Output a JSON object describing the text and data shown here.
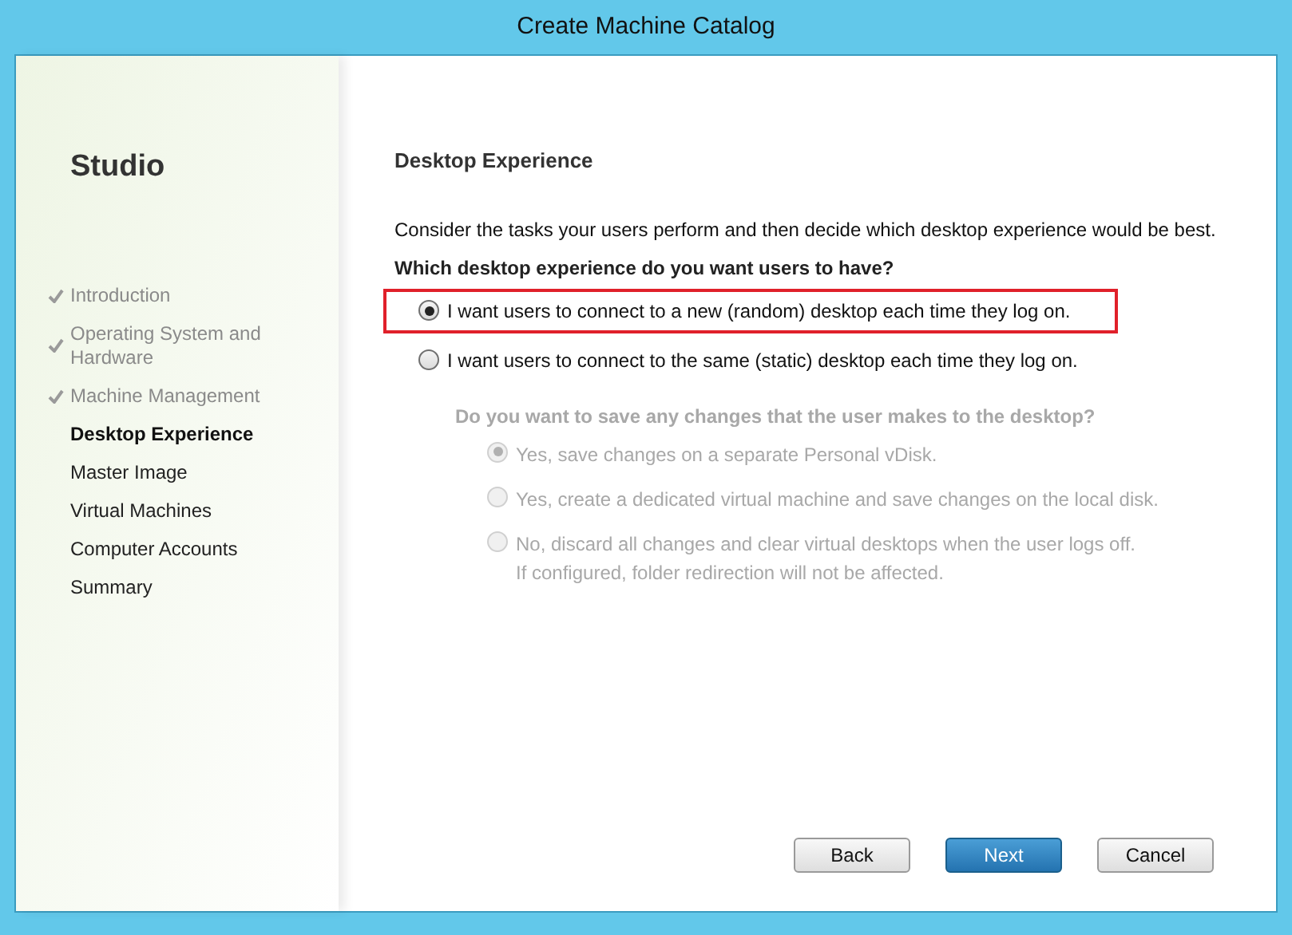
{
  "window": {
    "title": "Create Machine Catalog"
  },
  "sidebar": {
    "title": "Studio",
    "steps": [
      {
        "label": "Introduction",
        "completed": true,
        "selected": false
      },
      {
        "label": "Operating System and Hardware",
        "completed": true,
        "selected": false
      },
      {
        "label": "Machine Management",
        "completed": true,
        "selected": false
      },
      {
        "label": "Desktop Experience",
        "completed": false,
        "selected": true
      },
      {
        "label": "Master Image",
        "completed": false,
        "selected": false
      },
      {
        "label": "Virtual Machines",
        "completed": false,
        "selected": false
      },
      {
        "label": "Computer Accounts",
        "completed": false,
        "selected": false
      },
      {
        "label": "Summary",
        "completed": false,
        "selected": false
      }
    ]
  },
  "page": {
    "heading": "Desktop Experience",
    "intro": "Consider the tasks your users perform and then decide which desktop experience would be best.",
    "question": "Which desktop experience do you want users to have?",
    "options": [
      {
        "label": "I want users to connect to a new (random) desktop each time they log on.",
        "selected": true,
        "highlighted": true
      },
      {
        "label": "I want users to connect to the same (static) desktop each time they log on.",
        "selected": false,
        "highlighted": false
      }
    ],
    "sub_question": {
      "label": "Do you want to save any changes that the user makes to the desktop?",
      "disabled": true,
      "options": [
        {
          "label": "Yes, save changes on a separate Personal vDisk.",
          "selected": true
        },
        {
          "label": "Yes, create a dedicated virtual machine and save changes on the local disk.",
          "selected": false
        },
        {
          "label": "No, discard all changes and clear virtual desktops when the user logs off.",
          "note": "If configured, folder redirection will not be affected.",
          "selected": false
        }
      ]
    }
  },
  "buttons": [
    {
      "label": "Back",
      "primary": false
    },
    {
      "label": "Next",
      "primary": true
    },
    {
      "label": "Cancel",
      "primary": false
    }
  ]
}
